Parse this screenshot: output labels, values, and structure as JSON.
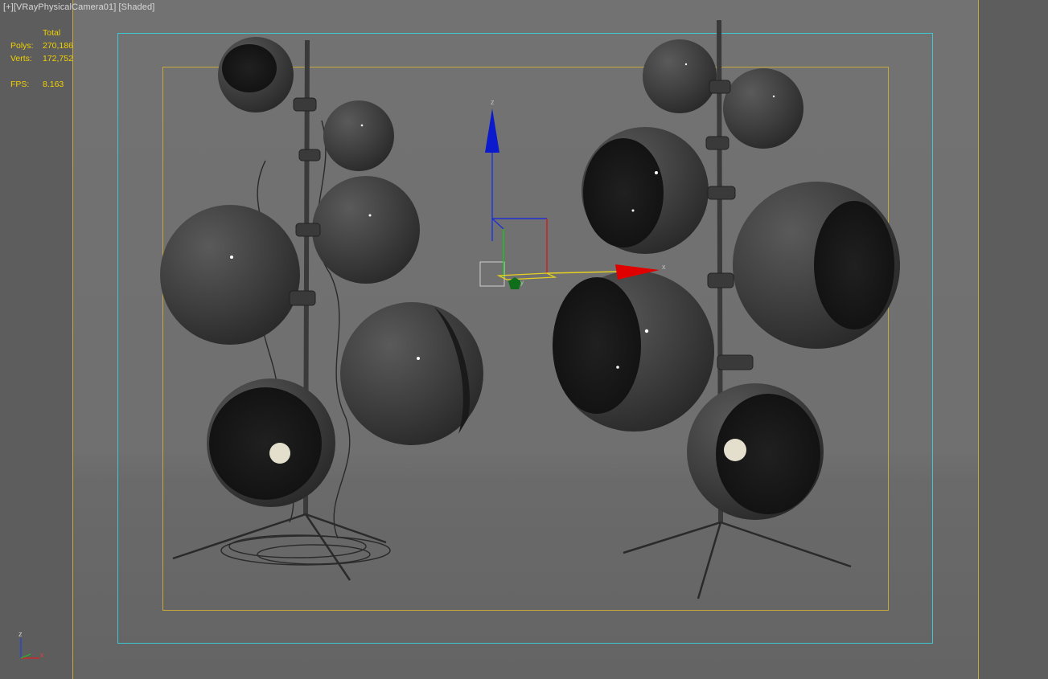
{
  "viewport": {
    "menu_label": "[+]",
    "camera_label": "[VRayPhysicalCamera01]",
    "shading_label": "[Shaded]"
  },
  "stats": {
    "header": "Total",
    "polys_label": "Polys:",
    "polys_value": "270,186",
    "verts_label": "Verts:",
    "verts_value": "172,752",
    "fps_label": "FPS:",
    "fps_value": "8.163"
  },
  "gizmo": {
    "z_label": "z",
    "x_label": "x",
    "y_label": "y"
  },
  "triad": {
    "z_label": "z",
    "x_label": "x"
  },
  "colors": {
    "stat_text": "#f0d000",
    "safe_frame_outer": "#3fc7cf",
    "safe_frame_inner": "#c8a83a",
    "gizmo_x": "#e00000",
    "gizmo_y": "#00c000",
    "gizmo_z": "#0000e0"
  }
}
